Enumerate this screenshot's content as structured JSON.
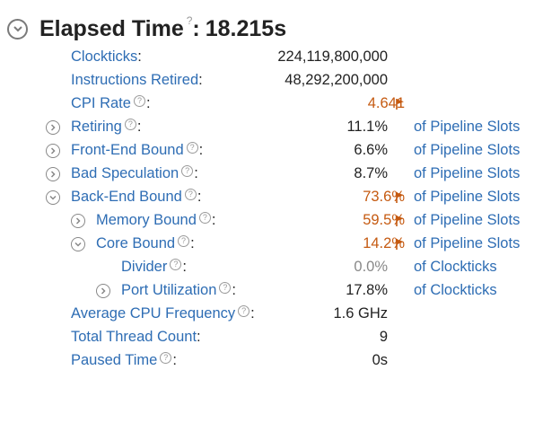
{
  "header": {
    "title": "Elapsed Time",
    "help": "?",
    "separator": ":",
    "value": "18.215s"
  },
  "rows": [
    {
      "label": "Clockticks",
      "colon": ":",
      "value": "224,119,800,000"
    },
    {
      "label": "Instructions Retired",
      "colon": ":",
      "value": "48,292,200,000"
    },
    {
      "label": "CPI Rate",
      "colon": ":",
      "help": "?",
      "value": "4.641"
    },
    {
      "label": "Retiring",
      "colon": ":",
      "help": "?",
      "value": "11.1%",
      "unit": "of Pipeline Slots"
    },
    {
      "label": "Front-End Bound",
      "colon": ":",
      "help": "?",
      "value": "6.6%",
      "unit": "of Pipeline Slots"
    },
    {
      "label": "Bad Speculation",
      "colon": ":",
      "help": "?",
      "value": "8.7%",
      "unit": "of Pipeline Slots"
    },
    {
      "label": "Back-End Bound",
      "colon": ":",
      "help": "?",
      "value": "73.6%",
      "unit": "of Pipeline Slots"
    },
    {
      "label": "Memory Bound",
      "colon": ":",
      "help": "?",
      "value": "59.5%",
      "unit": "of Pipeline Slots"
    },
    {
      "label": "Core Bound",
      "colon": ":",
      "help": "?",
      "value": "14.2%",
      "unit": "of Pipeline Slots"
    },
    {
      "label": "Divider",
      "colon": ":",
      "help": "?",
      "value": "0.0%",
      "unit": "of Clockticks"
    },
    {
      "label": "Port Utilization",
      "colon": ":",
      "help": "?",
      "value": "17.8%",
      "unit": "of Clockticks"
    },
    {
      "label": "Average CPU Frequency",
      "colon": ":",
      "help": "?",
      "value": "1.6 GHz"
    },
    {
      "label": "Total Thread Count",
      "colon": ":",
      "value": "9"
    },
    {
      "label": "Paused Time",
      "colon": ":",
      "help": "?",
      "value": "0s"
    }
  ],
  "colors": {
    "link": "#2e6db4",
    "flagged": "#c55a11",
    "text": "#222222",
    "icon": "#888888"
  },
  "icons": {
    "expanded": "chevron-down-icon",
    "collapsed": "chevron-right-icon",
    "flag": "flag-icon",
    "help": "help-icon"
  }
}
